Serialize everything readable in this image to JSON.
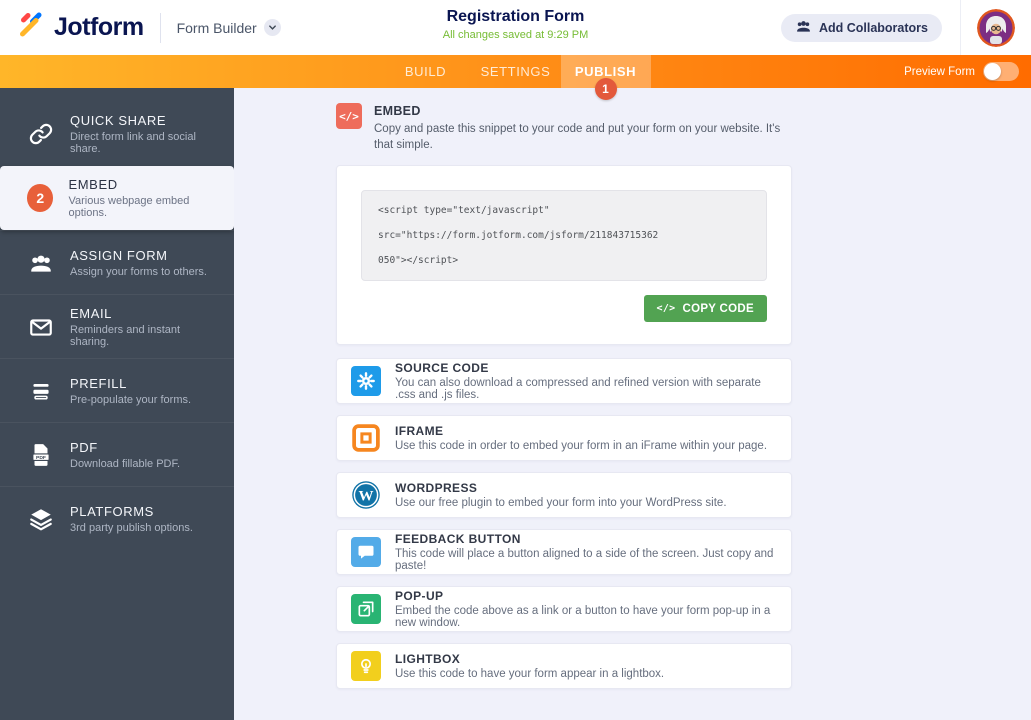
{
  "header": {
    "brand": "Jotform",
    "app_label": "Form Builder",
    "form_title": "Registration Form",
    "save_status": "All changes saved at 9:29 PM",
    "add_collaborators_label": "Add Collaborators"
  },
  "navbar": {
    "tabs": [
      {
        "label": "BUILD",
        "active": false
      },
      {
        "label": "SETTINGS",
        "active": false
      },
      {
        "label": "PUBLISH",
        "active": true,
        "step_badge": "1"
      }
    ],
    "preview_label": "Preview Form",
    "preview_toggle_state": "off"
  },
  "sidebar": {
    "items": [
      {
        "label": "QUICK SHARE",
        "desc": "Direct form link and social share.",
        "icon": "link-icon",
        "active": false
      },
      {
        "label": "EMBED",
        "desc": "Various webpage embed options.",
        "icon": "step-badge",
        "step_badge": "2",
        "active": true
      },
      {
        "label": "ASSIGN FORM",
        "desc": "Assign your forms to others.",
        "icon": "people-icon",
        "active": false
      },
      {
        "label": "EMAIL",
        "desc": "Reminders and instant sharing.",
        "icon": "envelope-icon",
        "active": false
      },
      {
        "label": "PREFILL",
        "desc": "Pre-populate your forms.",
        "icon": "prefill-icon",
        "active": false
      },
      {
        "label": "PDF",
        "desc": "Download fillable PDF.",
        "icon": "pdf-icon",
        "active": false
      },
      {
        "label": "PLATFORMS",
        "desc": "3rd party publish options.",
        "icon": "layers-icon",
        "active": false
      }
    ]
  },
  "main": {
    "section": {
      "title": "EMBED",
      "desc": "Copy and paste this snippet to your code and put your form on your website. It's that simple.",
      "icon": "code-icon",
      "icon_color": "#EE6C5B"
    },
    "code": {
      "lines": [
        "<script type=\"text/javascript\"",
        "src=\"https://form.jotform.com/jsform/211843715362",
        "050\"></script>"
      ],
      "copy_label": "COPY CODE",
      "copy_glyph": "</>"
    },
    "options": [
      {
        "title": "SOURCE CODE",
        "desc": "You can also download a compressed and refined version with separate .css and .js files.",
        "icon": "gear-icon",
        "color": "#1E9BE9"
      },
      {
        "title": "IFRAME",
        "desc": "Use this code in order to embed your form in an iFrame within your page.",
        "icon": "iframe-icon",
        "color": "#F6861F"
      },
      {
        "title": "WORDPRESS",
        "desc": "Use our free plugin to embed your form into your WordPress site.",
        "icon": "wordpress-icon",
        "color": "#1173A7"
      },
      {
        "title": "FEEDBACK BUTTON",
        "desc": "This code will place a button aligned to a side of the screen. Just copy and paste!",
        "icon": "speech-bubble-icon",
        "color": "#53ABE8"
      },
      {
        "title": "POP-UP",
        "desc": "Embed the code above as a link or a button to have your form pop-up in a new window.",
        "icon": "popup-window-icon",
        "color": "#29B473"
      },
      {
        "title": "LIGHTBOX",
        "desc": "Use this code to have your form appear in a lightbox.",
        "icon": "lightbulb-icon",
        "color": "#F2CF1D"
      }
    ]
  },
  "colors": {
    "nav_gradient_left": "#FFB629",
    "nav_gradient_right": "#FF6C00",
    "title_navy": "#0A1551",
    "save_status_green": "#76BC34",
    "copy_button_green": "#52A352",
    "step_badge_orange": "#E8603A",
    "sidebar_dark": "#3F4956",
    "main_background": "#F0F1FA"
  }
}
